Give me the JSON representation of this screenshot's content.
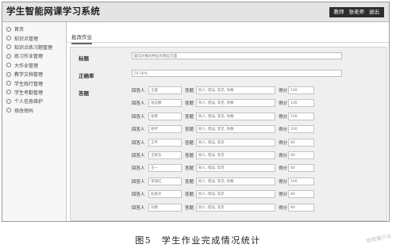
{
  "app": {
    "title": "学生智能网课学习系统"
  },
  "user_box": {
    "role": "教师",
    "user": "张老师",
    "logout": "退出"
  },
  "sidebar": {
    "items": [
      {
        "label": "首页"
      },
      {
        "label": "知识点管理"
      },
      {
        "label": "知识点练习题管理"
      },
      {
        "label": "练习作业管理"
      },
      {
        "label": "大作业管理"
      },
      {
        "label": "教学文档管理"
      },
      {
        "label": "学生践行管理"
      },
      {
        "label": "学生考勤管理"
      },
      {
        "label": "个人信息维护"
      },
      {
        "label": "修改密码"
      }
    ]
  },
  "main": {
    "tab": "批改作业",
    "title_label": "标题",
    "title_value": "面向对象的特征有哪些方面",
    "rate_label": "正确率",
    "rate_value": "54.56%",
    "answers_label": "答题",
    "row_labels": {
      "student": "回答人",
      "answer": "答题",
      "score": "得分"
    },
    "answers": [
      {
        "student": "王晨",
        "answer": "别人, 错误, 常见, 你数",
        "score": "100"
      },
      {
        "student": "张志鹏",
        "answer": "别人, 错误, 常见, 你数",
        "score": "100"
      },
      {
        "student": "张勇",
        "answer": "别人, 错误, 常见, 你数",
        "score": "100"
      },
      {
        "student": "杨宇",
        "answer": "别人, 错误, 常见, 你数",
        "score": "100"
      },
      {
        "student": "王平",
        "answer": "别人, 错误, 常见",
        "score": "80"
      },
      {
        "student": "王晓东",
        "answer": "别人, 错误, 常见",
        "score": "80"
      },
      {
        "student": "王一",
        "answer": "别人, 错误, 常见",
        "score": "80"
      },
      {
        "student": "李丽红",
        "answer": "别人, 错误, 常见, 你数",
        "score": "100"
      },
      {
        "student": "赵家文",
        "answer": "别人, 错误, 常见",
        "score": "80"
      },
      {
        "student": "刘明",
        "answer": "别人, 错误, 常见",
        "score": "80"
      }
    ]
  },
  "caption": "图5　学生作业完成情况统计",
  "watermark": "塔奇看行业"
}
